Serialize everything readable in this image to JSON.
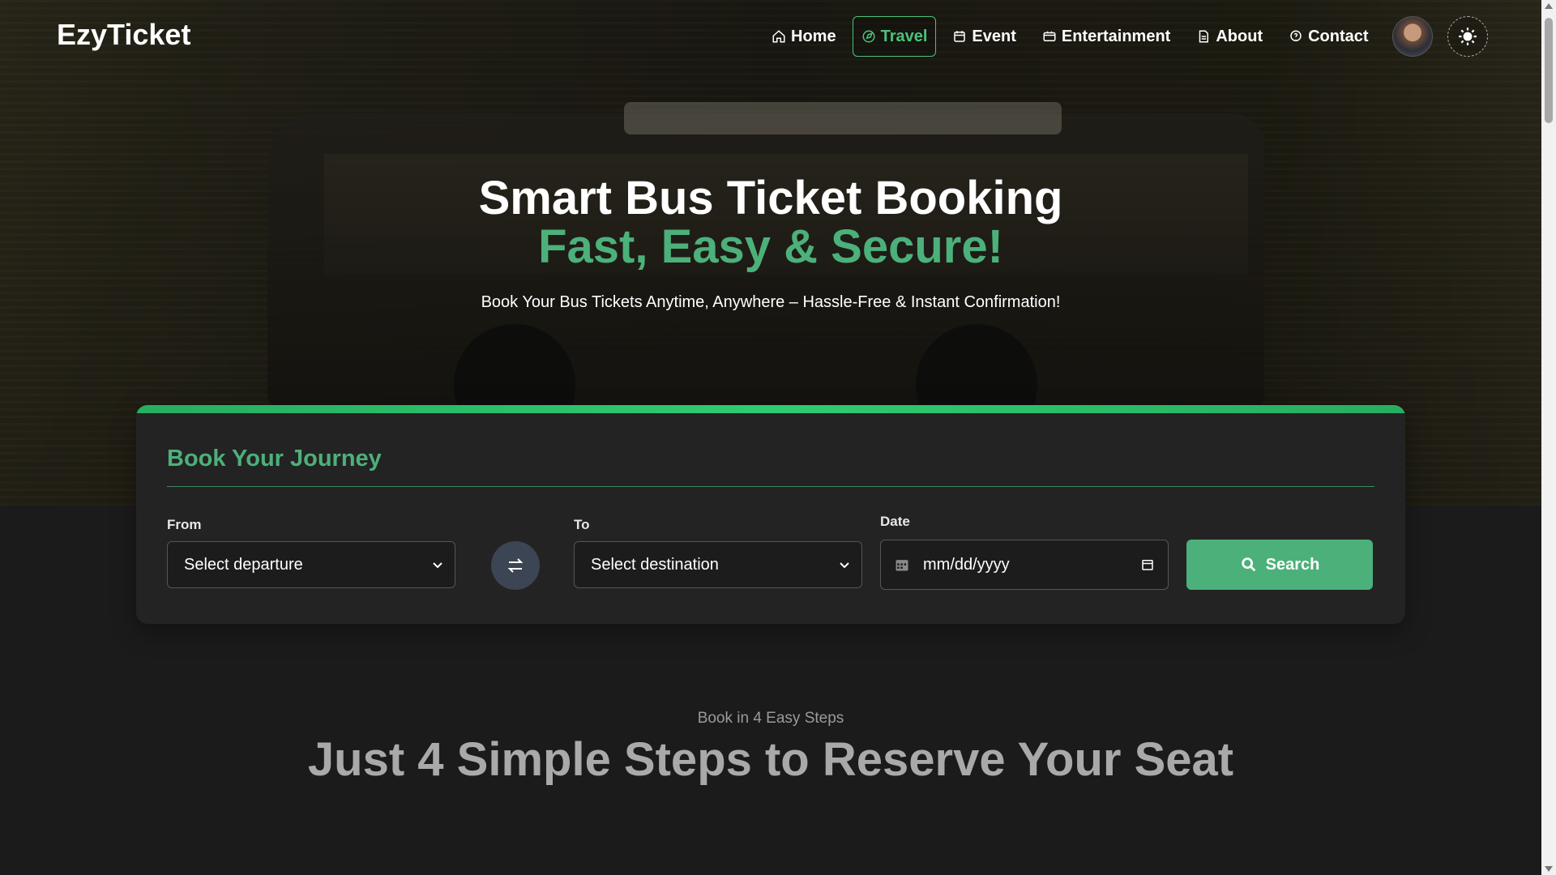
{
  "brand": {
    "name": "EzyTicket"
  },
  "nav": {
    "items": [
      {
        "label": "Home",
        "icon": "home-icon",
        "active": false
      },
      {
        "label": "Travel",
        "icon": "compass-icon",
        "active": true
      },
      {
        "label": "Event",
        "icon": "calendar-icon",
        "active": false
      },
      {
        "label": "Entertainment",
        "icon": "ticket-icon",
        "active": false
      },
      {
        "label": "About",
        "icon": "document-icon",
        "active": false
      },
      {
        "label": "Contact",
        "icon": "help-circle-icon",
        "active": false
      }
    ]
  },
  "hero": {
    "title_line1": "Smart Bus Ticket Booking",
    "title_line2": "Fast, Easy & Secure!",
    "subtitle": "Book Your Bus Tickets Anytime, Anywhere – Hassle-Free & Instant Confirmation!"
  },
  "booking": {
    "title": "Book Your Journey",
    "from_label": "From",
    "from_value": "Select departure",
    "to_label": "To",
    "to_value": "Select destination",
    "date_label": "Date",
    "date_placeholder": "mm/dd/yyyy",
    "search_label": "Search"
  },
  "steps": {
    "kicker": "Book in 4 Easy Steps",
    "title": "Just 4 Simple Steps to Reserve Your Seat"
  },
  "colors": {
    "accent": "#4cb07a",
    "background": "#1b1b1b",
    "card": "#232323"
  }
}
